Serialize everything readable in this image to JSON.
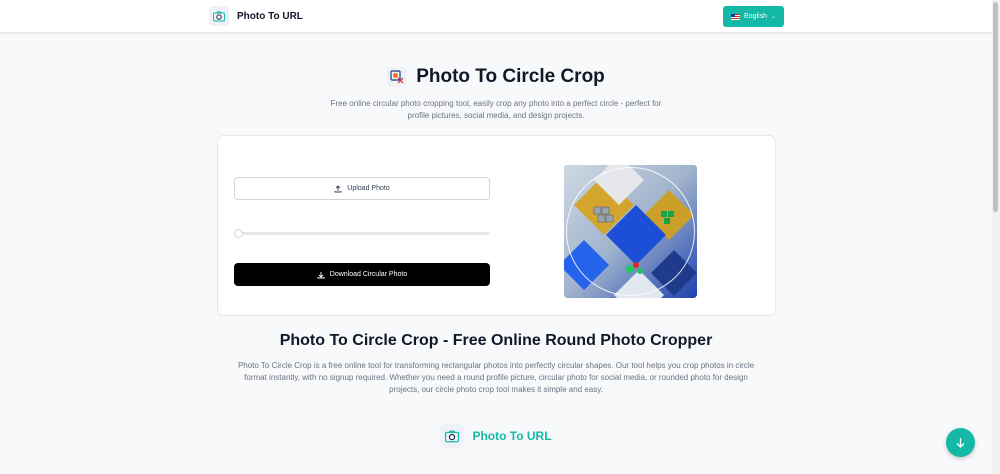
{
  "header": {
    "brand_name": "Photo To URL",
    "brand_icon": "photo-camera-icon",
    "language": {
      "label": "English",
      "flag_icon": "us-flag-icon",
      "chevron_icon": "chevron-down-icon"
    }
  },
  "hero": {
    "icon": "circle-crop-icon",
    "title": "Photo To Circle Crop",
    "description": "Free online circular photo cropping tool, easily crop any photo into a perfect circle - perfect for profile pictures, social media, and design projects."
  },
  "tool": {
    "upload_label": "Upload Photo",
    "upload_icon": "upload-icon",
    "slider_value": 0,
    "download_label": "Download Circular Photo",
    "download_icon": "download-icon"
  },
  "section": {
    "title": "Photo To Circle Crop - Free Online Round Photo Cropper",
    "description": "Photo To Circle Crop is a free online tool for transforming rectangular photos into perfectly circular shapes. Our tool helps you crop photos in circle format instantly, with no signup required. Whether you need a round profile picture, circular photo for social media, or rounded photo for design projects, our circle photo crop tool makes it simple and easy."
  },
  "footer": {
    "brand_name": "Photo To URL",
    "brand_icon": "photo-camera-icon"
  },
  "fab": {
    "icon": "arrow-down-icon"
  },
  "colors": {
    "accent": "#14b8a6",
    "primary_button": "#000000",
    "background": "#f8f9fb"
  }
}
